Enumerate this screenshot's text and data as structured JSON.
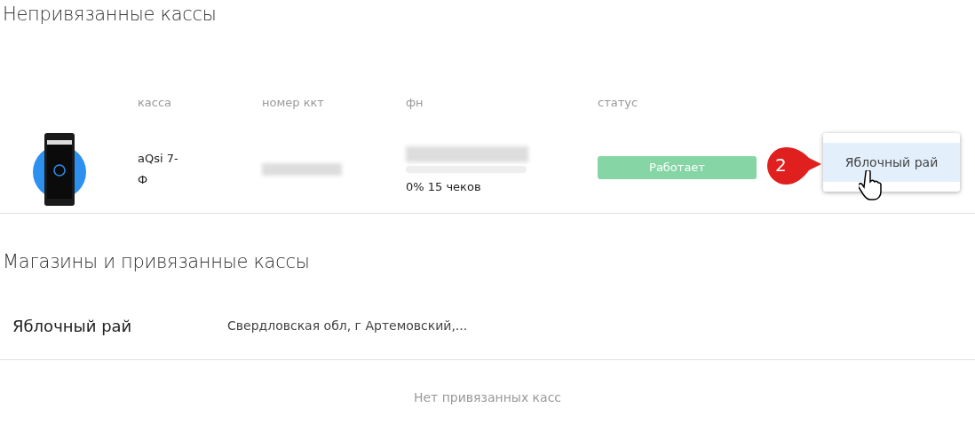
{
  "unbound_section": {
    "title": "Непривязанные кассы",
    "columns": [
      "касса",
      "номер ккт",
      "фн",
      "статус"
    ],
    "rows": [
      {
        "model": "aQsi 7-Ф",
        "fn_redacted": true,
        "serial_redacted": true,
        "fn_progress": {
          "level": 0
        },
        "fn_reading": "0% 15 чеков",
        "status": {
          "label": "Работает",
          "kind": "working"
        },
        "menu": {
          "items": [
            {
              "label": "Яблочный рай",
              "selected": true
            }
          ]
        },
        "callout": "2"
      }
    ]
  },
  "stores_section": {
    "title": "Магазины и привязанные кассы",
    "stores": [
      {
        "name": "Яблочный рай",
        "address": "Свердловская обл, г Артемовский,...",
        "empty_text": "Нет привязанных касс"
      }
    ]
  }
}
